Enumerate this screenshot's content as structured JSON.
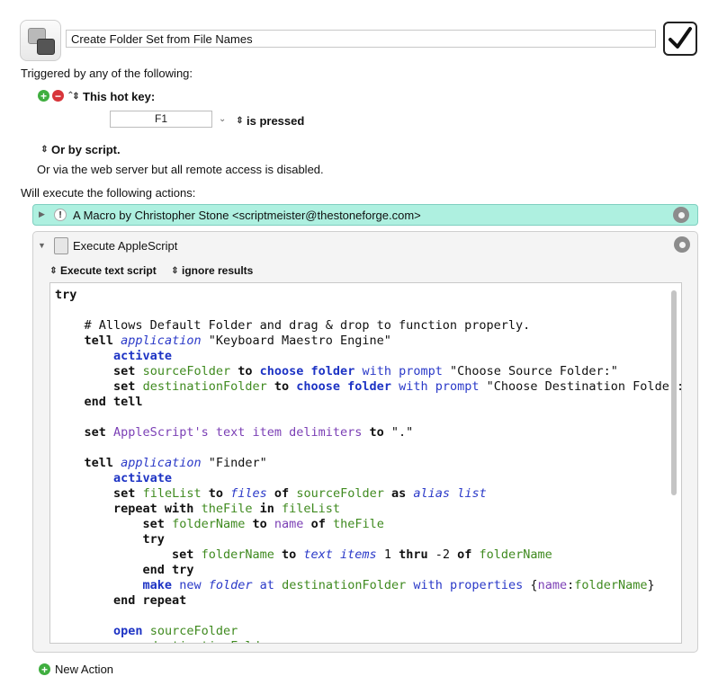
{
  "macro": {
    "name": "Create Folder Set from File Names",
    "enabled": true
  },
  "triggers": {
    "heading": "Triggered by any of the following:",
    "hotkey_label": "This hot key:",
    "hotkey_value": "F1",
    "hotkey_state": "is pressed",
    "or_script": "Or by script.",
    "web_server_note": "Or via the web server but all remote access is disabled."
  },
  "actions": {
    "heading": "Will execute the following actions:",
    "comment_action": {
      "title": "A Macro by Christopher Stone <scriptmeister@thestoneforge.com>",
      "color": "#aef0e0"
    },
    "applescript_action": {
      "title": "Execute AppleScript",
      "mode": "Execute text script",
      "results": "ignore results"
    },
    "new_action": "New Action"
  },
  "code_lines": [
    [
      {
        "t": "try",
        "c": "kw"
      }
    ],
    [],
    [
      {
        "t": "    # Allows Default Folder and drag & drop to function properly."
      }
    ],
    [
      {
        "t": "    "
      },
      {
        "t": "tell",
        "c": "kw"
      },
      {
        "t": " "
      },
      {
        "t": "application",
        "c": "app"
      },
      {
        "t": " \"Keyboard Maestro Engine\""
      }
    ],
    [
      {
        "t": "        "
      },
      {
        "t": "activate",
        "c": "kwb"
      }
    ],
    [
      {
        "t": "        "
      },
      {
        "t": "set",
        "c": "kw"
      },
      {
        "t": " "
      },
      {
        "t": "sourceFolder",
        "c": "var"
      },
      {
        "t": " "
      },
      {
        "t": "to",
        "c": "kw"
      },
      {
        "t": " "
      },
      {
        "t": "choose folder",
        "c": "kwb"
      },
      {
        "t": " "
      },
      {
        "t": "with prompt",
        "c": "cmd"
      },
      {
        "t": " \"Choose Source Folder:\""
      }
    ],
    [
      {
        "t": "        "
      },
      {
        "t": "set",
        "c": "kw"
      },
      {
        "t": " "
      },
      {
        "t": "destinationFolder",
        "c": "var"
      },
      {
        "t": " "
      },
      {
        "t": "to",
        "c": "kw"
      },
      {
        "t": " "
      },
      {
        "t": "choose folder",
        "c": "kwb"
      },
      {
        "t": " "
      },
      {
        "t": "with prompt",
        "c": "cmd"
      },
      {
        "t": " \"Choose Destination Folder:\""
      }
    ],
    [
      {
        "t": "    "
      },
      {
        "t": "end tell",
        "c": "kw"
      }
    ],
    [],
    [
      {
        "t": "    "
      },
      {
        "t": "set",
        "c": "kw"
      },
      {
        "t": " "
      },
      {
        "t": "AppleScript's text item delimiters",
        "c": "prop"
      },
      {
        "t": " "
      },
      {
        "t": "to",
        "c": "kw"
      },
      {
        "t": " \".\""
      }
    ],
    [],
    [
      {
        "t": "    "
      },
      {
        "t": "tell",
        "c": "kw"
      },
      {
        "t": " "
      },
      {
        "t": "application",
        "c": "app"
      },
      {
        "t": " \"Finder\""
      }
    ],
    [
      {
        "t": "        "
      },
      {
        "t": "activate",
        "c": "kwb"
      }
    ],
    [
      {
        "t": "        "
      },
      {
        "t": "set",
        "c": "kw"
      },
      {
        "t": " "
      },
      {
        "t": "fileList",
        "c": "var"
      },
      {
        "t": " "
      },
      {
        "t": "to",
        "c": "kw"
      },
      {
        "t": " "
      },
      {
        "t": "files",
        "c": "cls"
      },
      {
        "t": " "
      },
      {
        "t": "of",
        "c": "kw"
      },
      {
        "t": " "
      },
      {
        "t": "sourceFolder",
        "c": "var"
      },
      {
        "t": " "
      },
      {
        "t": "as",
        "c": "kw"
      },
      {
        "t": " "
      },
      {
        "t": "alias list",
        "c": "cls"
      }
    ],
    [
      {
        "t": "        "
      },
      {
        "t": "repeat with",
        "c": "kw"
      },
      {
        "t": " "
      },
      {
        "t": "theFile",
        "c": "var"
      },
      {
        "t": " "
      },
      {
        "t": "in",
        "c": "kw"
      },
      {
        "t": " "
      },
      {
        "t": "fileList",
        "c": "var"
      }
    ],
    [
      {
        "t": "            "
      },
      {
        "t": "set",
        "c": "kw"
      },
      {
        "t": " "
      },
      {
        "t": "folderName",
        "c": "var"
      },
      {
        "t": " "
      },
      {
        "t": "to",
        "c": "kw"
      },
      {
        "t": " "
      },
      {
        "t": "name",
        "c": "prop"
      },
      {
        "t": " "
      },
      {
        "t": "of",
        "c": "kw"
      },
      {
        "t": " "
      },
      {
        "t": "theFile",
        "c": "var"
      }
    ],
    [
      {
        "t": "            "
      },
      {
        "t": "try",
        "c": "kw"
      }
    ],
    [
      {
        "t": "                "
      },
      {
        "t": "set",
        "c": "kw"
      },
      {
        "t": " "
      },
      {
        "t": "folderName",
        "c": "var"
      },
      {
        "t": " "
      },
      {
        "t": "to",
        "c": "kw"
      },
      {
        "t": " "
      },
      {
        "t": "text items",
        "c": "cls"
      },
      {
        "t": " 1 "
      },
      {
        "t": "thru",
        "c": "kw"
      },
      {
        "t": " -2 "
      },
      {
        "t": "of",
        "c": "kw"
      },
      {
        "t": " "
      },
      {
        "t": "folderName",
        "c": "var"
      }
    ],
    [
      {
        "t": "            "
      },
      {
        "t": "end try",
        "c": "kw"
      }
    ],
    [
      {
        "t": "            "
      },
      {
        "t": "make",
        "c": "kwb"
      },
      {
        "t": " "
      },
      {
        "t": "new",
        "c": "cmd"
      },
      {
        "t": " "
      },
      {
        "t": "folder",
        "c": "cls"
      },
      {
        "t": " "
      },
      {
        "t": "at",
        "c": "cmd"
      },
      {
        "t": " "
      },
      {
        "t": "destinationFolder",
        "c": "var"
      },
      {
        "t": " "
      },
      {
        "t": "with properties",
        "c": "cmd"
      },
      {
        "t": " {"
      },
      {
        "t": "name",
        "c": "prop"
      },
      {
        "t": ":"
      },
      {
        "t": "folderName",
        "c": "var"
      },
      {
        "t": "}"
      }
    ],
    [
      {
        "t": "        "
      },
      {
        "t": "end repeat",
        "c": "kw"
      }
    ],
    [],
    [
      {
        "t": "        "
      },
      {
        "t": "open",
        "c": "kwb"
      },
      {
        "t": " "
      },
      {
        "t": "sourceFolder",
        "c": "var"
      }
    ],
    [
      {
        "t": "        "
      },
      {
        "t": "open",
        "c": "kwb"
      },
      {
        "t": " "
      },
      {
        "t": "destinationFolder",
        "c": "var"
      }
    ]
  ]
}
